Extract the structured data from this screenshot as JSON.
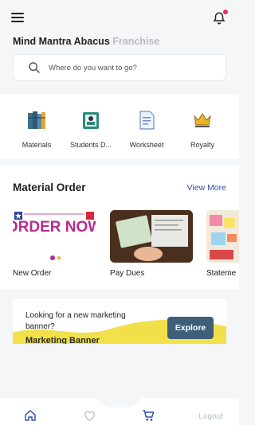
{
  "header": {
    "title_main": "Mind Mantra Abacus",
    "title_sub": "Franchise",
    "search_placeholder": "Where do you want to go?",
    "notification_dot_color": "#e4335b"
  },
  "quick_links": [
    {
      "label": "Materials",
      "icon": "books-icon"
    },
    {
      "label": "Students D...",
      "icon": "student-id-icon"
    },
    {
      "label": "Worksheet",
      "icon": "worksheet-icon"
    },
    {
      "label": "Royalty",
      "icon": "crown-icon"
    }
  ],
  "material_order": {
    "title": "Material Order",
    "view_more": "View More",
    "cards": [
      {
        "label": "New Order",
        "image_text": "ORDER NOW"
      },
      {
        "label": "Pay Dues"
      },
      {
        "label": "Stateme"
      }
    ]
  },
  "banner": {
    "text": "Looking for a new marketing banner?",
    "name": "Marketing Banner",
    "button": "Explore"
  },
  "bottom_nav": {
    "logout": "Logout",
    "active_color": "#2f4fb0"
  }
}
